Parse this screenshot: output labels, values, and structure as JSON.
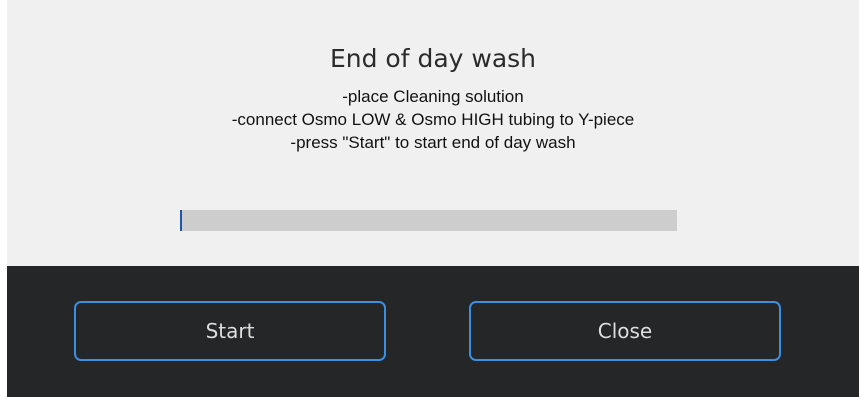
{
  "dialog": {
    "title": "End of day wash",
    "instructions": [
      "-place Cleaning solution",
      "-connect Osmo LOW & Osmo HIGH  tubing to Y-piece",
      "-press \"Start\" to start end of day wash"
    ],
    "progress": 0.004
  },
  "buttons": {
    "start_label": "Start",
    "close_label": "Close"
  },
  "colors": {
    "panel_bg": "#f0f0f0",
    "footer_bg": "#252627",
    "button_border": "#3b8fe0",
    "progress_track": "#cdcdcd",
    "progress_fill": "#1a56b0"
  }
}
